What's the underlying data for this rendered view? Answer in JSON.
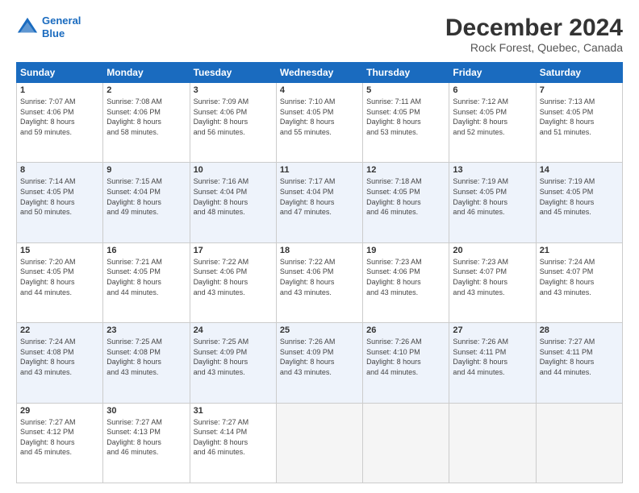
{
  "header": {
    "logo_line1": "General",
    "logo_line2": "Blue",
    "title": "December 2024",
    "subtitle": "Rock Forest, Quebec, Canada"
  },
  "days_of_week": [
    "Sunday",
    "Monday",
    "Tuesday",
    "Wednesday",
    "Thursday",
    "Friday",
    "Saturday"
  ],
  "weeks": [
    {
      "alt": false,
      "days": [
        {
          "num": "1",
          "info": "Sunrise: 7:07 AM\nSunset: 4:06 PM\nDaylight: 8 hours\nand 59 minutes."
        },
        {
          "num": "2",
          "info": "Sunrise: 7:08 AM\nSunset: 4:06 PM\nDaylight: 8 hours\nand 58 minutes."
        },
        {
          "num": "3",
          "info": "Sunrise: 7:09 AM\nSunset: 4:06 PM\nDaylight: 8 hours\nand 56 minutes."
        },
        {
          "num": "4",
          "info": "Sunrise: 7:10 AM\nSunset: 4:05 PM\nDaylight: 8 hours\nand 55 minutes."
        },
        {
          "num": "5",
          "info": "Sunrise: 7:11 AM\nSunset: 4:05 PM\nDaylight: 8 hours\nand 53 minutes."
        },
        {
          "num": "6",
          "info": "Sunrise: 7:12 AM\nSunset: 4:05 PM\nDaylight: 8 hours\nand 52 minutes."
        },
        {
          "num": "7",
          "info": "Sunrise: 7:13 AM\nSunset: 4:05 PM\nDaylight: 8 hours\nand 51 minutes."
        }
      ]
    },
    {
      "alt": true,
      "days": [
        {
          "num": "8",
          "info": "Sunrise: 7:14 AM\nSunset: 4:05 PM\nDaylight: 8 hours\nand 50 minutes."
        },
        {
          "num": "9",
          "info": "Sunrise: 7:15 AM\nSunset: 4:04 PM\nDaylight: 8 hours\nand 49 minutes."
        },
        {
          "num": "10",
          "info": "Sunrise: 7:16 AM\nSunset: 4:04 PM\nDaylight: 8 hours\nand 48 minutes."
        },
        {
          "num": "11",
          "info": "Sunrise: 7:17 AM\nSunset: 4:04 PM\nDaylight: 8 hours\nand 47 minutes."
        },
        {
          "num": "12",
          "info": "Sunrise: 7:18 AM\nSunset: 4:05 PM\nDaylight: 8 hours\nand 46 minutes."
        },
        {
          "num": "13",
          "info": "Sunrise: 7:19 AM\nSunset: 4:05 PM\nDaylight: 8 hours\nand 46 minutes."
        },
        {
          "num": "14",
          "info": "Sunrise: 7:19 AM\nSunset: 4:05 PM\nDaylight: 8 hours\nand 45 minutes."
        }
      ]
    },
    {
      "alt": false,
      "days": [
        {
          "num": "15",
          "info": "Sunrise: 7:20 AM\nSunset: 4:05 PM\nDaylight: 8 hours\nand 44 minutes."
        },
        {
          "num": "16",
          "info": "Sunrise: 7:21 AM\nSunset: 4:05 PM\nDaylight: 8 hours\nand 44 minutes."
        },
        {
          "num": "17",
          "info": "Sunrise: 7:22 AM\nSunset: 4:06 PM\nDaylight: 8 hours\nand 43 minutes."
        },
        {
          "num": "18",
          "info": "Sunrise: 7:22 AM\nSunset: 4:06 PM\nDaylight: 8 hours\nand 43 minutes."
        },
        {
          "num": "19",
          "info": "Sunrise: 7:23 AM\nSunset: 4:06 PM\nDaylight: 8 hours\nand 43 minutes."
        },
        {
          "num": "20",
          "info": "Sunrise: 7:23 AM\nSunset: 4:07 PM\nDaylight: 8 hours\nand 43 minutes."
        },
        {
          "num": "21",
          "info": "Sunrise: 7:24 AM\nSunset: 4:07 PM\nDaylight: 8 hours\nand 43 minutes."
        }
      ]
    },
    {
      "alt": true,
      "days": [
        {
          "num": "22",
          "info": "Sunrise: 7:24 AM\nSunset: 4:08 PM\nDaylight: 8 hours\nand 43 minutes."
        },
        {
          "num": "23",
          "info": "Sunrise: 7:25 AM\nSunset: 4:08 PM\nDaylight: 8 hours\nand 43 minutes."
        },
        {
          "num": "24",
          "info": "Sunrise: 7:25 AM\nSunset: 4:09 PM\nDaylight: 8 hours\nand 43 minutes."
        },
        {
          "num": "25",
          "info": "Sunrise: 7:26 AM\nSunset: 4:09 PM\nDaylight: 8 hours\nand 43 minutes."
        },
        {
          "num": "26",
          "info": "Sunrise: 7:26 AM\nSunset: 4:10 PM\nDaylight: 8 hours\nand 44 minutes."
        },
        {
          "num": "27",
          "info": "Sunrise: 7:26 AM\nSunset: 4:11 PM\nDaylight: 8 hours\nand 44 minutes."
        },
        {
          "num": "28",
          "info": "Sunrise: 7:27 AM\nSunset: 4:11 PM\nDaylight: 8 hours\nand 44 minutes."
        }
      ]
    },
    {
      "alt": false,
      "days": [
        {
          "num": "29",
          "info": "Sunrise: 7:27 AM\nSunset: 4:12 PM\nDaylight: 8 hours\nand 45 minutes."
        },
        {
          "num": "30",
          "info": "Sunrise: 7:27 AM\nSunset: 4:13 PM\nDaylight: 8 hours\nand 46 minutes."
        },
        {
          "num": "31",
          "info": "Sunrise: 7:27 AM\nSunset: 4:14 PM\nDaylight: 8 hours\nand 46 minutes."
        },
        {
          "num": "",
          "info": ""
        },
        {
          "num": "",
          "info": ""
        },
        {
          "num": "",
          "info": ""
        },
        {
          "num": "",
          "info": ""
        }
      ]
    }
  ]
}
